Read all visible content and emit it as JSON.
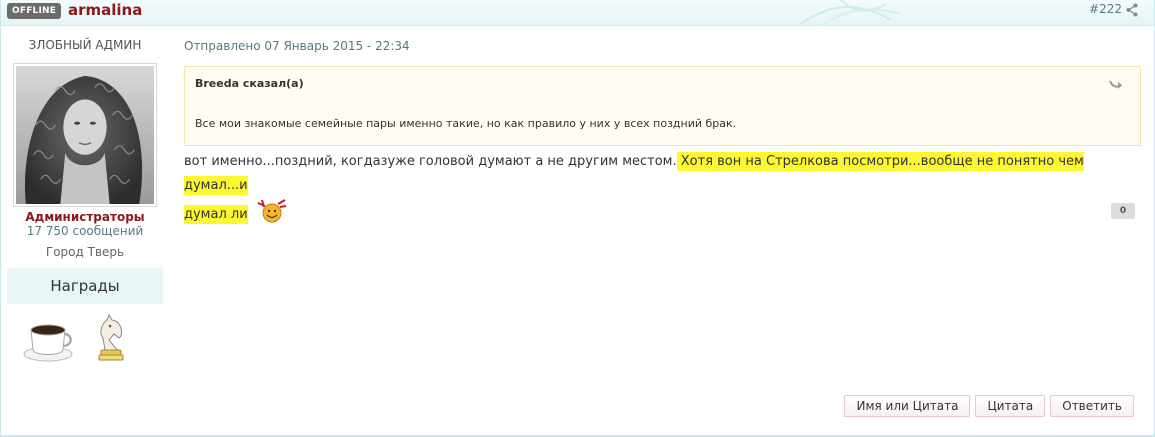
{
  "header": {
    "status_badge": "OFFLINE",
    "username": "armalina",
    "post_number": "#222",
    "share_icon": "share-icon"
  },
  "sidebar": {
    "user_title": "ЗЛОБНЫЙ АДМИН",
    "group_name": "Администраторы",
    "post_count": "17 750 сообщений",
    "city": "Город Тверь",
    "awards_label": "Награды",
    "award_icons": [
      "coffee-cup-icon",
      "chess-knight-icon"
    ]
  },
  "post": {
    "date": "Отправлено 07 Январь 2015 - 22:34",
    "quote": {
      "author": "Breeda сказал(а)",
      "text": "Все мои знакомые семейные пары именно такие, но как правило у них у всех поздний брак."
    },
    "text_plain": "вот именно...поздний, когдазуже головой думают а не другим местом.",
    "text_highlight_1": " Хотя вон на Стрелкова посмотри...вообще не понятно чем думал...и",
    "text_highlight_2": "думал ли",
    "reputation": "0"
  },
  "actions": {
    "multiquote_label": "Имя или Цитата",
    "quote_label": "Цитата",
    "reply_label": "Ответить"
  },
  "colors": {
    "username": "#8b1a1a",
    "highlight": "#fbf730",
    "header_bg": "#e6f4f6",
    "awards_bg": "#e9f6f8"
  }
}
